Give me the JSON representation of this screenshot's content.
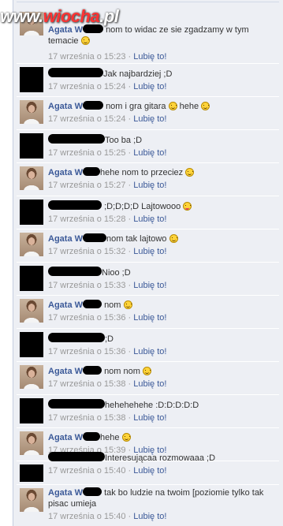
{
  "watermark": {
    "part1": "www.",
    "part2": "wiocha",
    "part3": ".pl"
  },
  "like_label": "Lubię to!",
  "separator": "·",
  "comments": [
    {
      "author": "Agata W",
      "text": "nom to widac ze sie zgadzamy w tym temacie",
      "time": "17 września o 15:23",
      "avatar": "photo-avatar"
    },
    {
      "author": "",
      "text": "Jak najbardziej ;D",
      "time": "17 września o 15:24",
      "avatar": "redacted-avatar"
    },
    {
      "author": "Agata W",
      "text": "nom i gra gitara",
      "text2": "hehe",
      "time": "17 września o 15:24",
      "avatar": "photo-avatar"
    },
    {
      "author": "",
      "text": "Too ba ;D",
      "time": "17 września o 15:25",
      "avatar": "redacted-avatar"
    },
    {
      "author": "Agata W",
      "text": "hehe nom to przeciez",
      "time": "17 września o 15:27",
      "avatar": "photo-avatar"
    },
    {
      "author": "",
      "text": ";D;D;D;D Lajtowooo",
      "time": "17 września o 15:28",
      "avatar": "redacted-avatar"
    },
    {
      "author": "Agata W",
      "text": "nom tak lajtowo",
      "time": "17 września o 15:32",
      "avatar": "photo-avatar"
    },
    {
      "author": "",
      "text": "Nioo ;D",
      "time": "17 września o 15:33",
      "avatar": "redacted-avatar"
    },
    {
      "author": "Agata W",
      "text": "nom",
      "time": "17 września o 15:36",
      "avatar": "photo-avatar"
    },
    {
      "author": "",
      "text": ";D",
      "time": "17 września o 15:36",
      "avatar": "redacted-avatar"
    },
    {
      "author": "Agata W",
      "text": "nom nom",
      "time": "17 września o 15:38",
      "avatar": "photo-avatar"
    },
    {
      "author": "",
      "text": "hehehehehe :D:D:D:D:D",
      "time": "17 września o 15:38",
      "avatar": "redacted-avatar"
    },
    {
      "author": "Agata W",
      "text": "hehe",
      "time": "17 września o 15:39",
      "avatar": "photo-avatar"
    },
    {
      "author": "",
      "text": "Interesującaa rozmowaaa ;D",
      "time": "17 września o 15:40",
      "avatar": "redacted-avatar"
    },
    {
      "author": "Agata W",
      "text": "tak bo ludzie na twoim [poziomie tylko tak pisac umieja",
      "time": "17 września o 15:40",
      "avatar": "photo-avatar"
    }
  ]
}
